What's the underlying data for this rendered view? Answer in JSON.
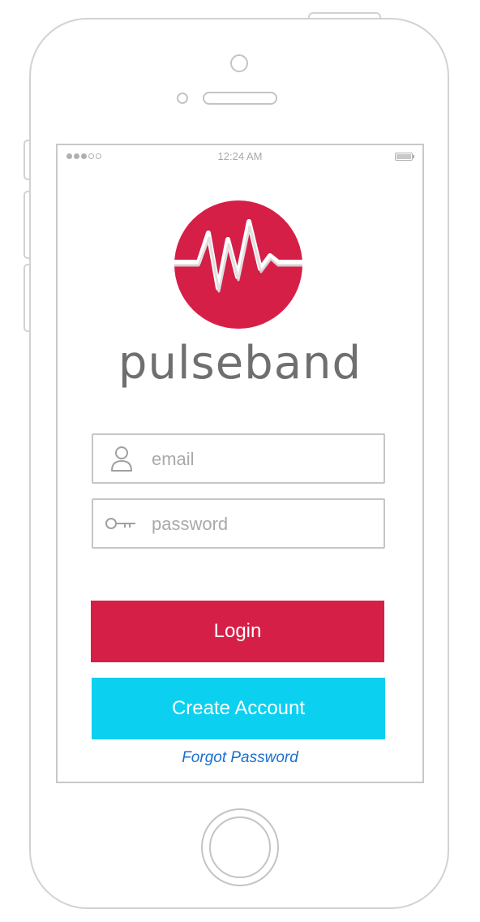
{
  "status_bar": {
    "time": "12:24 AM",
    "signal_dots_filled": 3,
    "signal_dots_total": 5,
    "battery_level": 1.0
  },
  "app": {
    "brand_name": "pulseband",
    "logo_icon": "pulse-wave-icon",
    "brand_color": "#d61f47"
  },
  "form": {
    "email": {
      "placeholder": "email",
      "value": "",
      "icon": "user-icon"
    },
    "password": {
      "placeholder": "password",
      "value": "",
      "icon": "key-icon"
    }
  },
  "actions": {
    "login_label": "Login",
    "login_color": "#d61f47",
    "create_label": "Create Account",
    "create_color": "#0bd0ef",
    "forgot_label": "Forgot Password",
    "forgot_color": "#1a6fd0"
  }
}
